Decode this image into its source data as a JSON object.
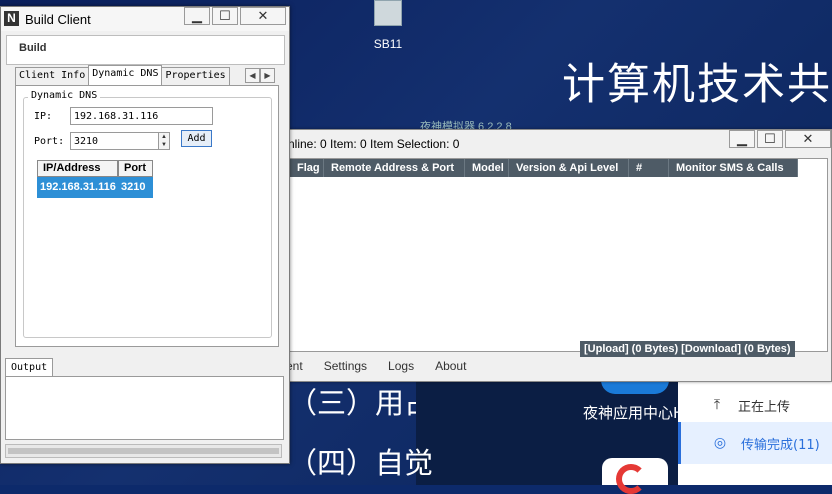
{
  "desktop": {
    "icon_label": "SB11",
    "big_text": "计算机技术共",
    "slide_lines": [
      "（三）用占",
      "（四）自觉"
    ],
    "nox_app_label": "夜神应用中心H",
    "nox_title": "夜神模拟器 6.2.2.8"
  },
  "transfer_panel": {
    "uploading": "正在上传",
    "done": "传输完成(11)",
    "upload_icon": "upload-icon",
    "done_icon": "check-circle-icon",
    "active_color": "#2a6fdb"
  },
  "monitor": {
    "title": "nline: 0 Item: 0 Item Selection: 0",
    "columns": [
      "Flag",
      "Remote Address & Port",
      "Model",
      "Version & Api Level",
      "#",
      "Monitor SMS & Calls"
    ],
    "status": "[Upload] (0 Bytes) [Download] (0 Bytes)",
    "menu": [
      "ent",
      "Settings",
      "Logs",
      "About"
    ],
    "header_color": "#4e5b66"
  },
  "build_client": {
    "title": "Build Client",
    "logo": "N",
    "menu_label": "Build",
    "tabs": [
      "Client Info",
      "Dynamic DNS",
      "Properties"
    ],
    "active_tab": "Dynamic DNS",
    "group_label": "Dynamic DNS",
    "ip_label": "IP:",
    "ip_value": "192.168.31.116",
    "port_label": "Port:",
    "port_value": "3210",
    "add_button": "Add",
    "table": {
      "headers": [
        "IP/Address",
        "Port"
      ],
      "rows": [
        [
          "192.168.31.116",
          "3210"
        ]
      ]
    },
    "output_tab": "Output",
    "selection_color": "#2d8fd6"
  },
  "window_buttons": {
    "minimize": "▁",
    "maximize": "☐",
    "close": "✕"
  }
}
